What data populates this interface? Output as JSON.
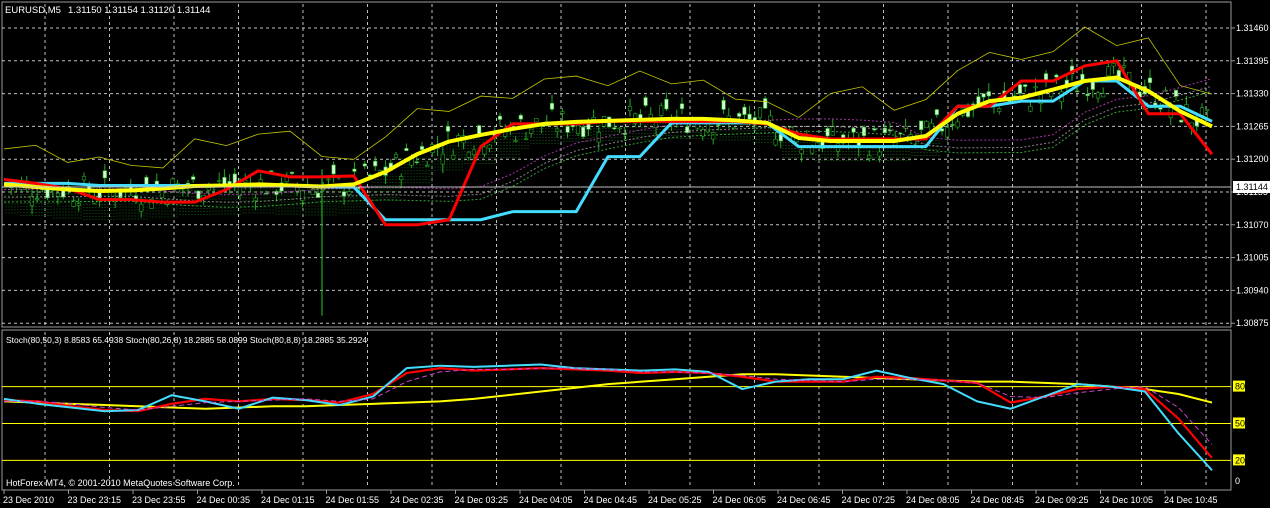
{
  "header": {
    "symbol": "EURUSD,M5",
    "ohlc": "1.31150 1.31154 1.31120 1.31144"
  },
  "price_label": "1.31144",
  "stoch_header": "Stoch(80,50,3) 8.8583 65.4938   Stoch(80,26,8) 18.2885 58.0899   Stoch(80,8,8) 18.2885 35.2924",
  "footer_copyright": "HotForex MT4, © 2001-2010 MetaQuotes Software Corp.",
  "colors": {
    "background": "#000000",
    "grid": "#ffffff",
    "candle_up": "#ccffcc",
    "candle_down": "#000000",
    "wick": "#22aa22",
    "red_line": "#ff0000",
    "cyan_line": "#44ddff",
    "yellow_line": "#ffff00",
    "yellow_thin": "#c8c800",
    "magenta_dash": "#cc44cc",
    "level_line": "#ffff00"
  },
  "chart_data": [
    {
      "type": "line",
      "title": "EURUSD,M5",
      "y_ticks": [
        "1.31460",
        "1.31395",
        "1.31330",
        "1.31265",
        "1.31200",
        "1.31135",
        "1.31070",
        "1.31005",
        "1.30940",
        "1.30875"
      ],
      "ylim": [
        1.30875,
        1.3148
      ],
      "x_ticks": [
        "23 Dec 2010",
        "23 Dec 23:15",
        "23 Dec 23:55",
        "24 Dec 00:35",
        "24 Dec 01:15",
        "24 Dec 01:55",
        "24 Dec 02:35",
        "24 Dec 03:25",
        "24 Dec 04:05",
        "24 Dec 04:45",
        "24 Dec 05:25",
        "24 Dec 06:05",
        "24 Dec 06:45",
        "24 Dec 07:25",
        "24 Dec 08:05",
        "24 Dec 08:45",
        "24 Dec 09:25",
        "24 Dec 10:05",
        "24 Dec 10:45"
      ],
      "current_price": 1.31144,
      "series": [
        {
          "color": "yellow",
          "values": [
            1.3115,
            1.31145,
            1.3114,
            1.31137,
            1.31138,
            1.31142,
            1.31147,
            1.31148,
            1.3115,
            1.31148,
            1.31146,
            1.3115,
            1.31175,
            1.3121,
            1.31235,
            1.31248,
            1.3126,
            1.3127,
            1.31274,
            1.31276,
            1.31278,
            1.3128,
            1.3128,
            1.31277,
            1.31272,
            1.31242,
            1.31236,
            1.31236,
            1.31236,
            1.31246,
            1.3129,
            1.31315,
            1.31322,
            1.31338,
            1.31355,
            1.31362,
            1.31335,
            1.31295,
            1.31265
          ]
        },
        {
          "color": "red",
          "values": [
            1.3116,
            1.31152,
            1.31142,
            1.3112,
            1.3112,
            1.31115,
            1.31115,
            1.3114,
            1.31177,
            1.31165,
            1.31165,
            1.31167,
            1.3107,
            1.3107,
            1.3108,
            1.31225,
            1.3127,
            1.3127,
            1.3127,
            1.31275,
            1.31275,
            1.31275,
            1.31275,
            1.31275,
            1.3127,
            1.3125,
            1.3124,
            1.3124,
            1.3124,
            1.3124,
            1.31305,
            1.31305,
            1.31355,
            1.31355,
            1.31385,
            1.31395,
            1.3129,
            1.3129,
            1.3121
          ]
        },
        {
          "color": "cyan",
          "values": [
            1.31152,
            1.31152,
            1.31152,
            1.31148,
            1.31148,
            1.31148,
            1.31148,
            1.31148,
            1.31148,
            1.31148,
            1.31145,
            1.31145,
            1.3108,
            1.3108,
            1.3108,
            1.3108,
            1.31096,
            1.31096,
            1.31096,
            1.31205,
            1.31205,
            1.31272,
            1.31272,
            1.31272,
            1.31272,
            1.31225,
            1.31225,
            1.31225,
            1.31225,
            1.31225,
            1.31305,
            1.31305,
            1.31315,
            1.31315,
            1.31355,
            1.31355,
            1.31305,
            1.31305,
            1.31275
          ]
        }
      ]
    },
    {
      "type": "line",
      "title": "Stoch",
      "ylim": [
        0,
        100
      ],
      "y_ticks": [
        "80",
        "50",
        "20",
        "0"
      ],
      "levels": [
        80,
        50,
        20
      ],
      "series": [
        {
          "name": "Stoch(80,50,3)",
          "color": "yellow",
          "values": [
            68,
            67,
            66,
            65,
            64,
            63,
            62,
            63,
            64,
            64,
            65,
            66,
            67,
            68,
            70,
            73,
            76,
            79,
            82,
            84,
            86,
            88,
            90,
            90,
            89,
            88,
            87,
            86,
            85,
            84,
            84,
            83,
            82,
            80,
            78,
            74,
            67
          ]
        },
        {
          "name": "Stoch(80,26,8)",
          "color": "red",
          "values": [
            69,
            68,
            64,
            61,
            60,
            66,
            70,
            68,
            70,
            69,
            67,
            74,
            91,
            95,
            93,
            94,
            95,
            94,
            93,
            91,
            92,
            91,
            88,
            84,
            84,
            84,
            88,
            87,
            85,
            83,
            67,
            72,
            78,
            80,
            78,
            54,
            22
          ]
        },
        {
          "name": "Stoch(80,8,8)",
          "color": "cyan",
          "values": [
            70,
            66,
            63,
            60,
            61,
            73,
            68,
            62,
            71,
            69,
            65,
            72,
            95,
            97,
            96,
            97,
            98,
            95,
            94,
            93,
            94,
            92,
            78,
            84,
            86,
            86,
            93,
            87,
            82,
            68,
            62,
            72,
            82,
            80,
            76,
            42,
            12
          ]
        },
        {
          "name": "signal",
          "color": "magenta",
          "values": [
            68,
            68,
            66,
            63,
            61,
            64,
            67,
            68,
            69,
            70,
            68,
            70,
            84,
            92,
            94,
            94,
            95,
            95,
            94,
            92,
            92,
            91,
            89,
            86,
            85,
            84,
            86,
            86,
            85,
            83,
            72,
            71,
            75,
            78,
            80,
            63,
            33
          ]
        }
      ]
    }
  ]
}
